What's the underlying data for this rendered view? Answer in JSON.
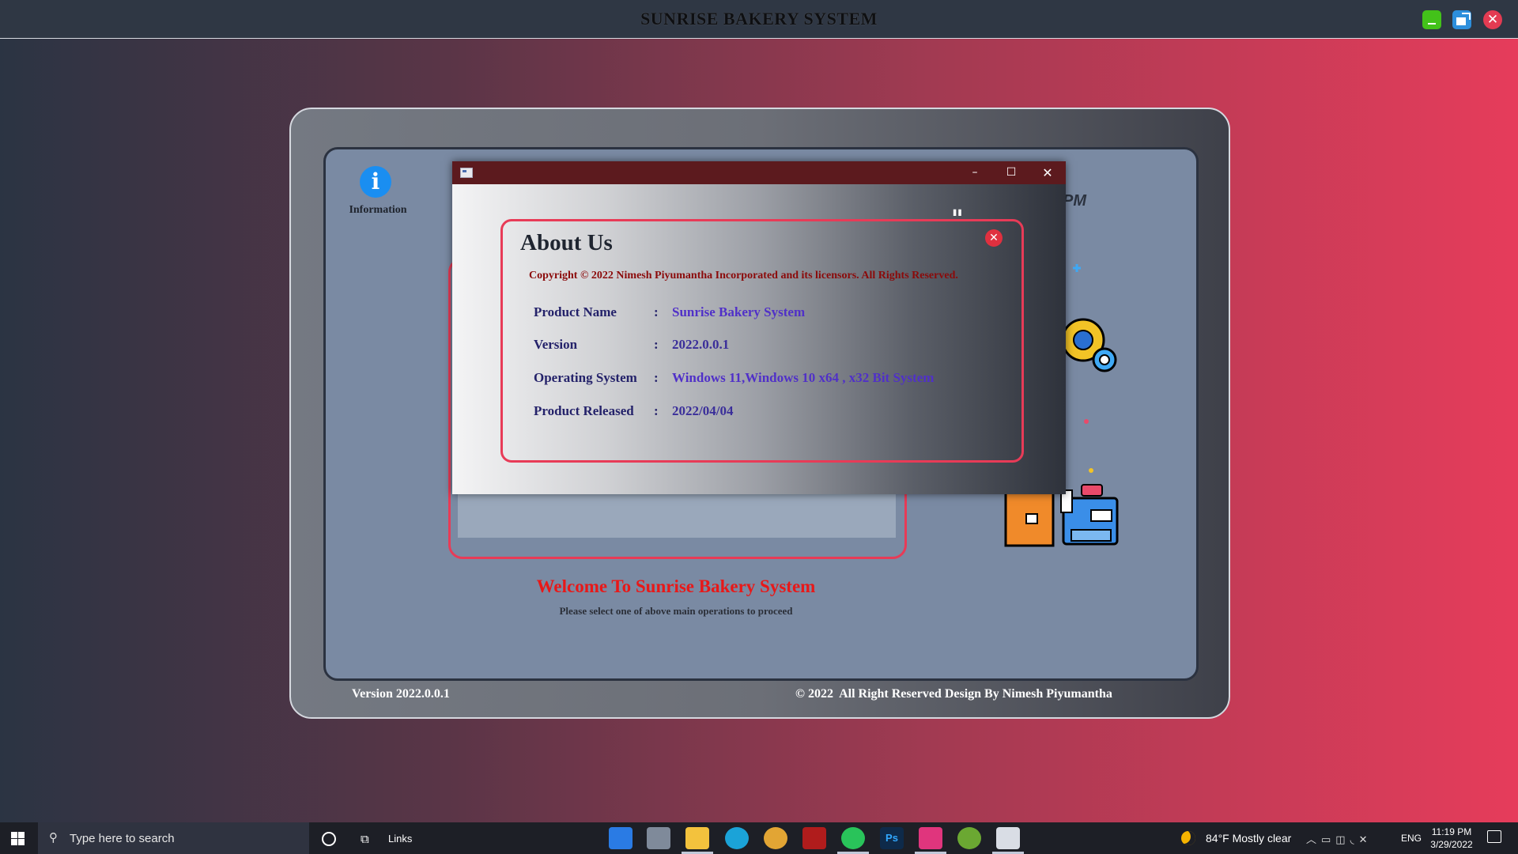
{
  "app": {
    "title": "SUNRISE BAKERY SYSTEM",
    "window_controls": {
      "minimize": "minimize",
      "maximize": "maximize",
      "close": "✕"
    }
  },
  "main": {
    "info_label": "Information",
    "clock_fragment": "PM",
    "welcome_title": "Welcome To Sunrise Bakery System",
    "welcome_sub": "Please select one of above main operations to proceed",
    "footer_version": "Version 2022.0.0.1",
    "footer_copyright": "© 2022  All Right Reserved Design By Nimesh Piyumantha"
  },
  "about_dialog": {
    "controls": {
      "minimize": "–",
      "maximize": "☐",
      "close": "✕"
    },
    "title": "About Us",
    "copyright": "Copyright © 2022 Nimesh Piyumantha Incorporated and its licensors. All Rights Reserved.",
    "close_glyph": "✕",
    "quote_glyph": "\"",
    "rows": [
      {
        "label": "Product Name",
        "sep": ":",
        "value": "Sunrise Bakery System"
      },
      {
        "label": "Version",
        "sep": ":",
        "value": "2022.0.0.1"
      },
      {
        "label": "Operating System",
        "sep": ":",
        "value": "Windows 11,Windows 10 x64 , x32 Bit System"
      },
      {
        "label": "Product Released",
        "sep": ":",
        "value": "2022/04/04"
      }
    ]
  },
  "taskbar": {
    "search_placeholder": "Type here to search",
    "links_label": "Links",
    "apps": [
      "mail",
      "file-manager",
      "file-explorer",
      "edge",
      "chrome",
      "filezilla",
      "whatsapp",
      "photoshop",
      "intellij",
      "snagit",
      "java"
    ],
    "weather": "84°F  Mostly clear",
    "language": "ENG",
    "time": "11:19 PM",
    "date": "3/29/2022"
  },
  "colors": {
    "accent_red": "#e83b57",
    "dialog_titlebar": "#5c1a1e",
    "value_purple": "#5030c8",
    "welcome_red": "#e81818"
  }
}
